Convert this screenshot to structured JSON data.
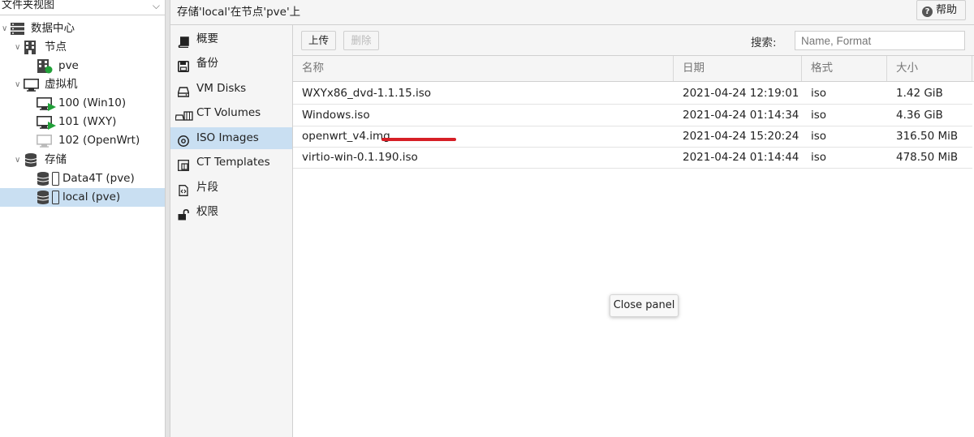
{
  "left_panel": {
    "view_selector": "文件夹视图",
    "tree": {
      "datacenter": "数据中心",
      "nodes_group": "节点",
      "node_pve": "pve",
      "vms_group": "虚拟机",
      "vm_100": "100 (Win10)",
      "vm_101": "101 (WXY)",
      "vm_102": "102 (OpenWrt)",
      "storage_group": "存储",
      "storage_data4t": "Data4T (pve)",
      "storage_local": "local (pve)"
    }
  },
  "header": {
    "title": "存储'local'在节点'pve'上",
    "help_label": "帮助"
  },
  "nav": {
    "items": [
      {
        "label": "概要",
        "icon": "book-icon"
      },
      {
        "label": "备份",
        "icon": "floppy-icon"
      },
      {
        "label": "VM Disks",
        "icon": "hdd-icon"
      },
      {
        "label": "CT Volumes",
        "icon": "container-icon"
      },
      {
        "label": "ISO Images",
        "icon": "disc-icon"
      },
      {
        "label": "CT Templates",
        "icon": "template-icon"
      },
      {
        "label": "片段",
        "icon": "file-code-icon"
      },
      {
        "label": "权限",
        "icon": "unlock-icon"
      }
    ],
    "active": "ISO Images"
  },
  "toolbar": {
    "upload_label": "上传",
    "delete_label": "删除",
    "search_label": "搜索:",
    "search_placeholder": "Name, Format",
    "search_value": ""
  },
  "grid": {
    "columns": [
      "名称",
      "日期",
      "格式",
      "大小"
    ],
    "rows": [
      {
        "name": "WXYx86_dvd-1.1.15.iso",
        "date": "2021-04-24 12:19:01",
        "format": "iso",
        "size": "1.42 GiB"
      },
      {
        "name": "Windows.iso",
        "date": "2021-04-24 01:14:34",
        "format": "iso",
        "size": "4.36 GiB"
      },
      {
        "name": "openwrt_v4.img",
        "date": "2021-04-24 15:20:24",
        "format": "iso",
        "size": "316.50 MiB"
      },
      {
        "name": "virtio-win-0.1.190.iso",
        "date": "2021-04-24 01:14:44",
        "format": "iso",
        "size": "478.50 MiB"
      }
    ]
  },
  "tooltip": "Close panel",
  "colors": {
    "selection": "#c9dff2",
    "annotation": "#d61f26",
    "vm_running": "#21a038"
  }
}
